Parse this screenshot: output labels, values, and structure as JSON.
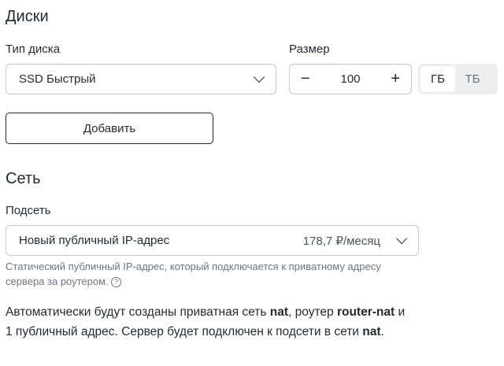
{
  "disks": {
    "title": "Диски",
    "type_label": "Тип диска",
    "type_value": "SSD Быстрый",
    "size_label": "Размер",
    "size_value": "100",
    "minus": "−",
    "plus": "+",
    "units": [
      "ГБ",
      "ТБ"
    ],
    "add_button": "Добавить"
  },
  "network": {
    "title": "Сеть",
    "subnet_label": "Подсеть",
    "subnet_value": "Новый публичный IP-адрес",
    "subnet_price": "178,7 ₽/месяц",
    "hint": "Статический публичный IP-адрес, который подключается к приватному адресу сервера за роутером.",
    "help_icon": "?",
    "info": {
      "p1": "Автоматически будут созданы приватная сеть ",
      "b1": "nat",
      "p2": ", роутер ",
      "b2": "router-nat",
      "p3": " и 1 публичный адрес. Сервер будет подключен к подсети в сети ",
      "b3": "nat",
      "p4": "."
    }
  }
}
